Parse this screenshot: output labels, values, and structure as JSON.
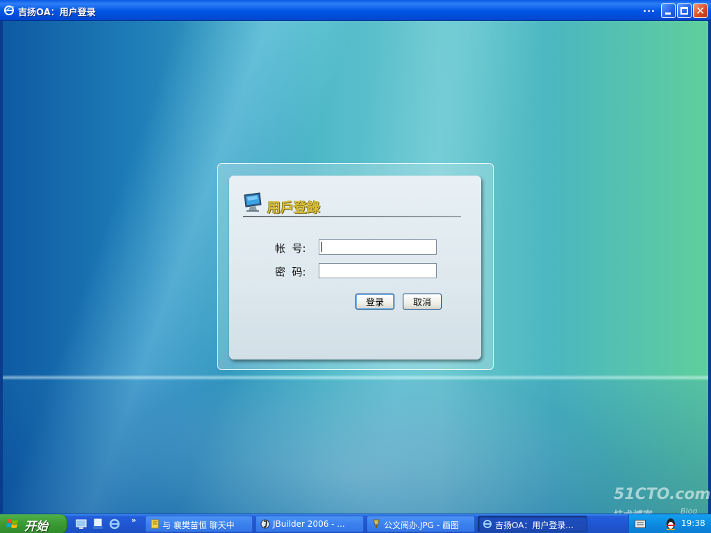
{
  "window": {
    "title": "吉扬OA：用户登录",
    "dots": "...",
    "icon": "ie-icon",
    "controls": [
      "minimize-icon",
      "maximize-icon",
      "close-icon"
    ]
  },
  "login": {
    "heading": "用戶登錄",
    "heading_icon": "monitor-icon",
    "username_label": "帐  号:",
    "username_value": "",
    "password_label": "密  码:",
    "password_value": "",
    "login_button": "登录",
    "cancel_button": "取消"
  },
  "taskbar": {
    "start_label": "开始",
    "quick_launch": [
      "desktop-icon",
      "outlook-icon",
      "ie-icon"
    ],
    "more": "»",
    "tasks": [
      {
        "icon": "chat-icon",
        "label": "与 襄樊苗恒 聊天中",
        "active": false
      },
      {
        "icon": "jbuilder-icon",
        "label": "JBuilder 2006 - ...",
        "active": false
      },
      {
        "icon": "paint-icon",
        "label": "公文阅办.JPG - 画图",
        "active": false
      },
      {
        "icon": "ie-icon",
        "label": "吉扬OA：用户登录...",
        "active": true
      }
    ],
    "tray": {
      "icons": [
        "keyboard-icon",
        "qq-penguin-icon"
      ],
      "clock": "19:38"
    }
  },
  "watermark": {
    "main": "51CTO.com",
    "sub": "技术博客",
    "blog": "Blog"
  },
  "colors": {
    "titlebar": "#0055e5",
    "taskbar": "#245edb",
    "start": "#3c9c36",
    "heading": "#d9c13a"
  }
}
